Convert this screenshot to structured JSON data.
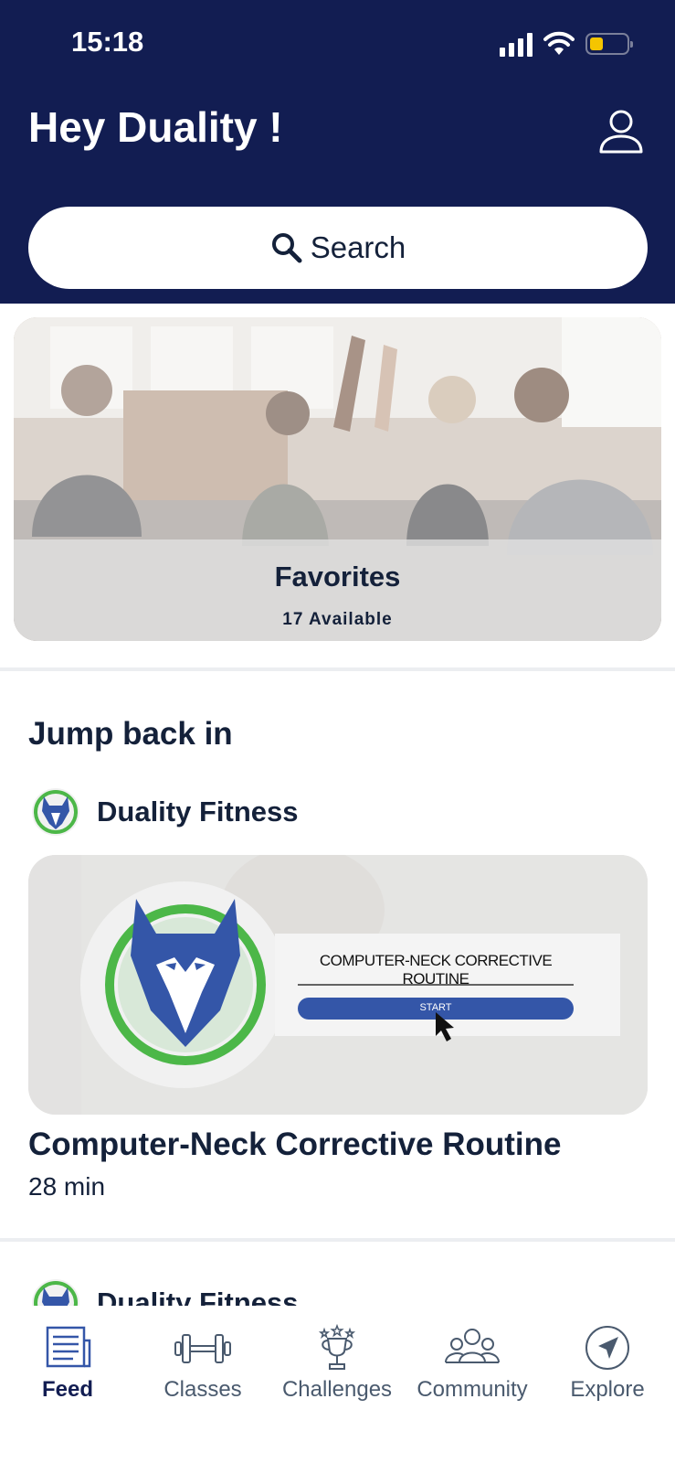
{
  "status_bar": {
    "time": "15:18"
  },
  "header": {
    "greeting": "Hey Duality !"
  },
  "search": {
    "label": "Search"
  },
  "favorites": {
    "title": "Favorites",
    "subtitle": "17 Available"
  },
  "jump_back": {
    "title": "Jump back in",
    "studio": "Duality Fitness",
    "thumbnail": {
      "heading": "COMPUTER-NECK CORRECTIVE ROUTINE",
      "button": "START"
    },
    "class_title": "Computer-Neck Corrective Routine",
    "duration": "28 min"
  },
  "next_item": {
    "studio": "Duality Fitness"
  },
  "bottom_nav": [
    {
      "label": "Feed",
      "icon": "feed-icon",
      "active": true
    },
    {
      "label": "Classes",
      "icon": "dumbbell-icon",
      "active": false
    },
    {
      "label": "Challenges",
      "icon": "trophy-icon",
      "active": false
    },
    {
      "label": "Community",
      "icon": "community-icon",
      "active": false
    },
    {
      "label": "Explore",
      "icon": "compass-icon",
      "active": false
    }
  ],
  "colors": {
    "header_bg": "#121d52",
    "brand_blue": "#3456a8",
    "brand_green": "#4cb748",
    "text": "#14213a"
  }
}
